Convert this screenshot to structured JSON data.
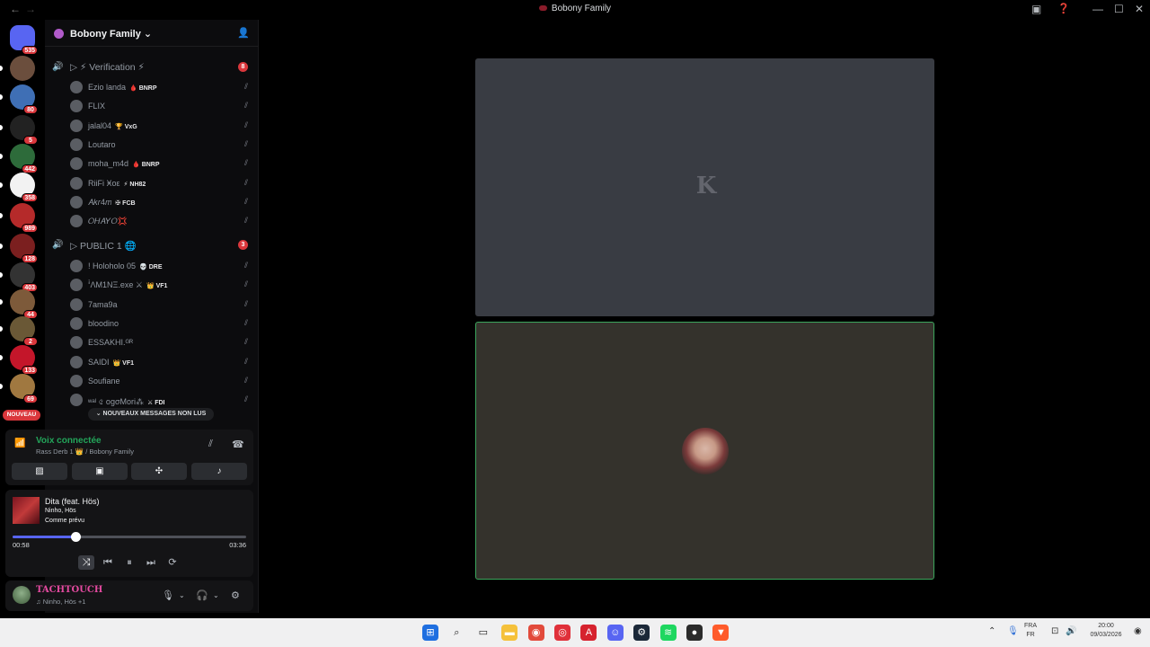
{
  "window": {
    "title": "Bobony Family",
    "back_icon": "←",
    "forward_icon": "→"
  },
  "rail": {
    "servers": [
      {
        "name": "discord-home",
        "badge": "535",
        "color": "#5865f2"
      },
      {
        "name": "server-2",
        "badge": "",
        "color": "#6b4e3d"
      },
      {
        "name": "server-3",
        "badge": "80",
        "color": "#3f6fb5"
      },
      {
        "name": "server-4",
        "badge": "5",
        "color": "#222"
      },
      {
        "name": "server-5",
        "badge": "442",
        "color": "#2d6b3a"
      },
      {
        "name": "server-6",
        "badge": "358",
        "color": "#f2f2f2"
      },
      {
        "name": "server-7",
        "badge": "989",
        "color": "#b52a2a"
      },
      {
        "name": "server-8",
        "badge": "128",
        "color": "#7b1f1f"
      },
      {
        "name": "server-9",
        "badge": "403",
        "color": "#333"
      },
      {
        "name": "server-10",
        "badge": "44",
        "color": "#7d5a3a"
      },
      {
        "name": "server-11",
        "badge": "2",
        "color": "#6a5836"
      },
      {
        "name": "server-12",
        "badge": "133",
        "color": "#c4162a"
      },
      {
        "name": "server-13",
        "badge": "69",
        "color": "#a07840"
      }
    ],
    "new_label": "NOUVEAU"
  },
  "guild": {
    "name": "Bobony Family",
    "chevron": "⌄",
    "add_people_icon": "👤"
  },
  "channels": {
    "verification": {
      "label": "▷ ⚡ Verification ⚡",
      "count": "8"
    },
    "public": {
      "label": "▷ PUBLIC 1 🌐",
      "count": "3"
    }
  },
  "verification_users": [
    {
      "name": "Ezio landa",
      "tag": "🩸 BNRP"
    },
    {
      "name": "FLIX",
      "tag": ""
    },
    {
      "name": "jalal04",
      "tag": "🏆 VxG"
    },
    {
      "name": "Loutaro",
      "tag": ""
    },
    {
      "name": "moha_m4d",
      "tag": "🩸 BNRP"
    },
    {
      "name": "RiiFi Ӿoε",
      "tag": "⚡ NH82"
    },
    {
      "name": "𝐴𝑘𝑟4𝑚",
      "tag": "✠ FCB"
    },
    {
      "name": "𝑂𝐻𝐴𝑌𝑂💢",
      "tag": ""
    }
  ],
  "public_users": [
    {
      "name": "! Holoholo 05",
      "tag": "💀 DRE"
    },
    {
      "name": "ꜞΛМ1ΝΞ.exe ⚔",
      "tag": "👑 VF1"
    },
    {
      "name": "7ama9a",
      "tag": ""
    },
    {
      "name": "bloodino",
      "tag": ""
    },
    {
      "name": "ESSAKHI.ᴳᴿ",
      "tag": ""
    },
    {
      "name": "SAIDI",
      "tag": "👑 VF1"
    },
    {
      "name": "Soufiane",
      "tag": ""
    },
    {
      "name": "ʷᵃˡ ৫ ogσMori⁂",
      "tag": "⚔ FDI"
    }
  ],
  "unread_label": "⌄ NOUVEAUX MESSAGES NON LUS",
  "voice": {
    "status": "Voix connectée",
    "location": "Rass Derb 1 👑 / Bobony Family",
    "buttons": [
      "camera-off",
      "screen-share",
      "activities",
      "soundboard"
    ]
  },
  "spotify": {
    "song": "Dita (feat. Hös)",
    "artist": "Ninho, Hös",
    "album": "Comme prévu",
    "elapsed": "00:58",
    "duration": "03:36",
    "progress": 0.27
  },
  "user": {
    "name": "TACHTOUCH",
    "status": "♫ Ninho, Hös +1"
  },
  "taskbar": {
    "lang_top": "FRA",
    "lang_bottom": "FR",
    "time": "20:00",
    "date": "09/03/2026",
    "apps": [
      "windows-start",
      "search",
      "task-view",
      "file-explorer",
      "chrome",
      "opera",
      "adobe",
      "discord",
      "steam",
      "spotify",
      "obs",
      "brave"
    ]
  }
}
